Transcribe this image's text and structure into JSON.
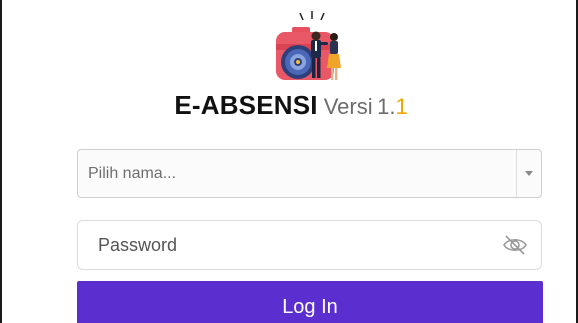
{
  "app": {
    "brand": "E-ABSENSI",
    "version_label": "Versi",
    "version_major": "1.",
    "version_minor": "1",
    "accent_color": "#5b2fcf",
    "version_highlight_color": "#f0a500"
  },
  "logo": {
    "icon": "camera-with-people-icon"
  },
  "form": {
    "name_select": {
      "placeholder": "Pilih nama...",
      "icon": "chevron-down-icon"
    },
    "password": {
      "placeholder": "Password",
      "icon": "eye-off-icon"
    },
    "login_label": "Log In"
  }
}
